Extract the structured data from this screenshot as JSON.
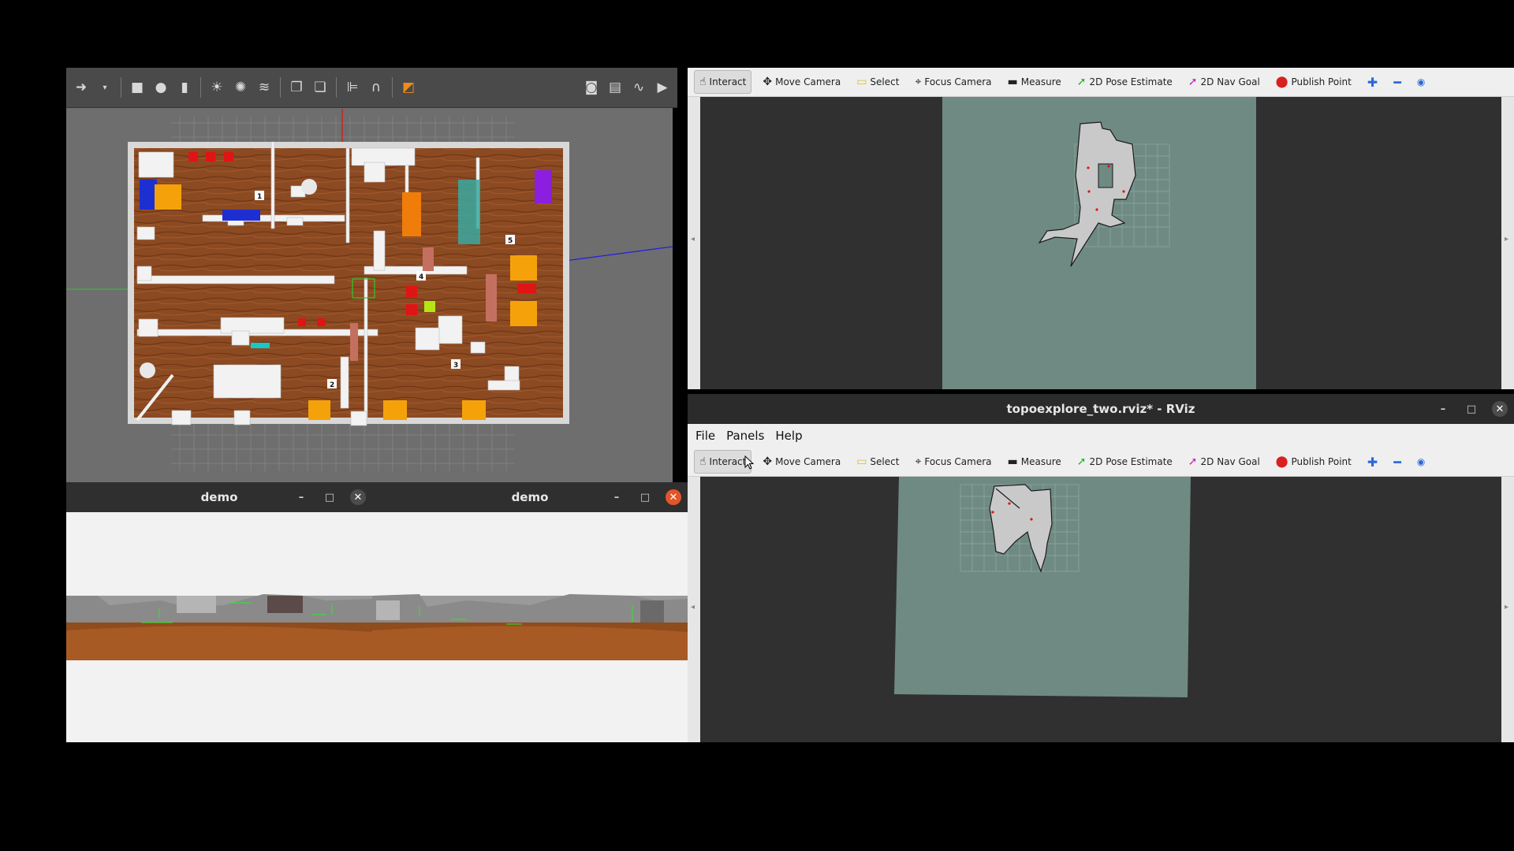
{
  "gazebo": {
    "toolbar_icons": [
      "arrow-icon",
      "chevron-down-icon",
      "box-icon",
      "sphere-icon",
      "cylinder-icon",
      "point-light-icon",
      "spot-light-icon",
      "directional-light-icon",
      "copy-icon",
      "paste-icon",
      "align-icon",
      "magnet-icon",
      "snap-icon",
      "screenshot-icon",
      "log-icon",
      "plot-icon",
      "video-icon"
    ],
    "room_labels": [
      "1",
      "5",
      "4",
      "3",
      "2"
    ]
  },
  "demo_windows": [
    {
      "title": "demo",
      "close_style": "grey"
    },
    {
      "title": "demo",
      "close_style": "orange"
    }
  ],
  "rviz_toolbar": {
    "interact": "Interact",
    "move_camera": "Move Camera",
    "select": "Select",
    "focus_camera": "Focus Camera",
    "measure": "Measure",
    "pose_estimate": "2D Pose Estimate",
    "nav_goal": "2D Nav Goal",
    "publish_point": "Publish Point"
  },
  "rviz2": {
    "title": "topoexplore_two.rviz* - RViz",
    "menu": [
      "File",
      "Panels",
      "Help"
    ]
  },
  "colors": {
    "map_area": "#6f8a83",
    "floor": "#8a4a22",
    "accent_orange": "#e2552b"
  }
}
